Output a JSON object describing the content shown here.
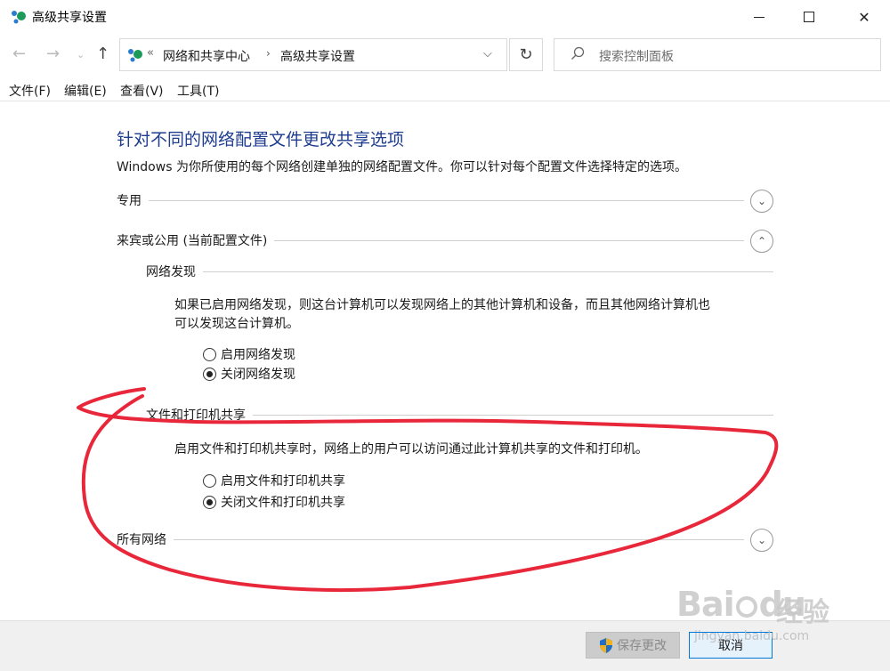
{
  "window": {
    "title": "高级共享设置",
    "controls": {
      "minimize": "minimize",
      "maximize": "maximize",
      "close": "✕"
    }
  },
  "address": {
    "overflow": "«",
    "crumbs": [
      "网络和共享中心",
      "高级共享设置"
    ],
    "crumb_sep": "›",
    "dropdown": "⌵",
    "refresh": "↻",
    "search_placeholder": "搜索控制面板"
  },
  "nav": {
    "back": "←",
    "forward": "→",
    "recent": "⌄",
    "up": "↑"
  },
  "menu": [
    "文件(F)",
    "编辑(E)",
    "查看(V)",
    "工具(T)"
  ],
  "content": {
    "heading": "针对不同的网络配置文件更改共享选项",
    "intro": "Windows 为你所使用的每个网络创建单独的网络配置文件。你可以针对每个配置文件选择特定的选项。",
    "profiles": {
      "private": {
        "label": "专用",
        "chevron": "⌄"
      },
      "guest": {
        "label": "来宾或公用 (当前配置文件)",
        "chevron": "⌃"
      },
      "all": {
        "label": "所有网络",
        "chevron": "⌄"
      }
    },
    "network_discovery": {
      "title": "网络发现",
      "desc_line1": "如果已启用网络发现，则这台计算机可以发现网络上的其他计算机和设备，而且其他网络计算机也",
      "desc_line2": "可以发现这台计算机。",
      "options": [
        {
          "label": "启用网络发现",
          "checked": false
        },
        {
          "label": "关闭网络发现",
          "checked": true
        }
      ]
    },
    "file_print": {
      "title": "文件和打印机共享",
      "desc": "启用文件和打印机共享时，网络上的用户可以访问通过此计算机共享的文件和打印机。",
      "options": [
        {
          "label": "启用文件和打印机共享",
          "checked": false
        },
        {
          "label": "关闭文件和打印机共享",
          "checked": true
        }
      ]
    }
  },
  "footer": {
    "save_label": "保存更改",
    "cancel_label": "取消"
  },
  "watermark": {
    "brand": "Bai",
    "brand2": "du",
    "jingyan": "经验",
    "url": "jingyan.baidu.com"
  },
  "colors": {
    "heading": "#1e3d8f",
    "annotation": "#e8283a",
    "cancel_border": "#0078d7"
  }
}
